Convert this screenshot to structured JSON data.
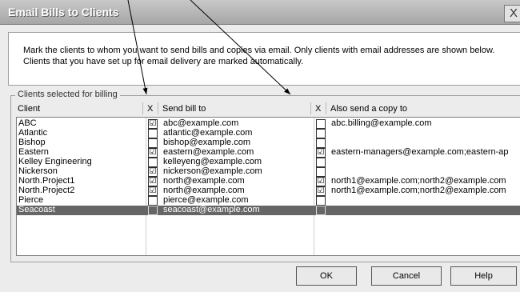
{
  "window": {
    "title": "Email Bills to Clients",
    "close_label": "X"
  },
  "info_text": "Mark the clients to whom you want to send bills and copies via email. Only clients with email addresses are shown below. Clients that you have set up for email delivery are marked automatically.",
  "group_label": "Clients selected for billing",
  "columns": {
    "client": "Client",
    "x1": "X",
    "send": "Send bill to",
    "x2": "X",
    "copy": "Also send a copy to"
  },
  "check_glyph": "☑",
  "rows": [
    {
      "client": "ABC",
      "send_checked": true,
      "send": "abc@example.com",
      "copy_checked": false,
      "copy": "abc.billing@example.com",
      "selected": false
    },
    {
      "client": "Atlantic",
      "send_checked": false,
      "send": "atlantic@example.com",
      "copy_checked": false,
      "copy": "",
      "selected": false
    },
    {
      "client": "Bishop",
      "send_checked": false,
      "send": "bishop@example.com",
      "copy_checked": false,
      "copy": "",
      "selected": false
    },
    {
      "client": "Eastern",
      "send_checked": true,
      "send": "eastern@example.com",
      "copy_checked": true,
      "copy": "eastern-managers@example.com;eastern-ap",
      "selected": false
    },
    {
      "client": "Kelley Engineering",
      "send_checked": false,
      "send": "kelleyeng@example.com",
      "copy_checked": false,
      "copy": "",
      "selected": false
    },
    {
      "client": "Nickerson",
      "send_checked": true,
      "send": "nickerson@example.com",
      "copy_checked": false,
      "copy": "",
      "selected": false
    },
    {
      "client": "North.Project1",
      "send_checked": true,
      "send": "north@example.com",
      "copy_checked": true,
      "copy": "north1@example.com;north2@example.com",
      "selected": false
    },
    {
      "client": "North.Project2",
      "send_checked": true,
      "send": "north@example.com",
      "copy_checked": true,
      "copy": "north1@example.com;north2@example.com",
      "selected": false
    },
    {
      "client": "Pierce",
      "send_checked": false,
      "send": "pierce@example.com",
      "copy_checked": false,
      "copy": "",
      "selected": false
    },
    {
      "client": "Seacoast",
      "send_checked": false,
      "send": "seacoast@example.com",
      "copy_checked": false,
      "copy": "",
      "selected": true
    }
  ],
  "buttons": {
    "ok": "OK",
    "cancel": "Cancel",
    "help": "Help"
  }
}
